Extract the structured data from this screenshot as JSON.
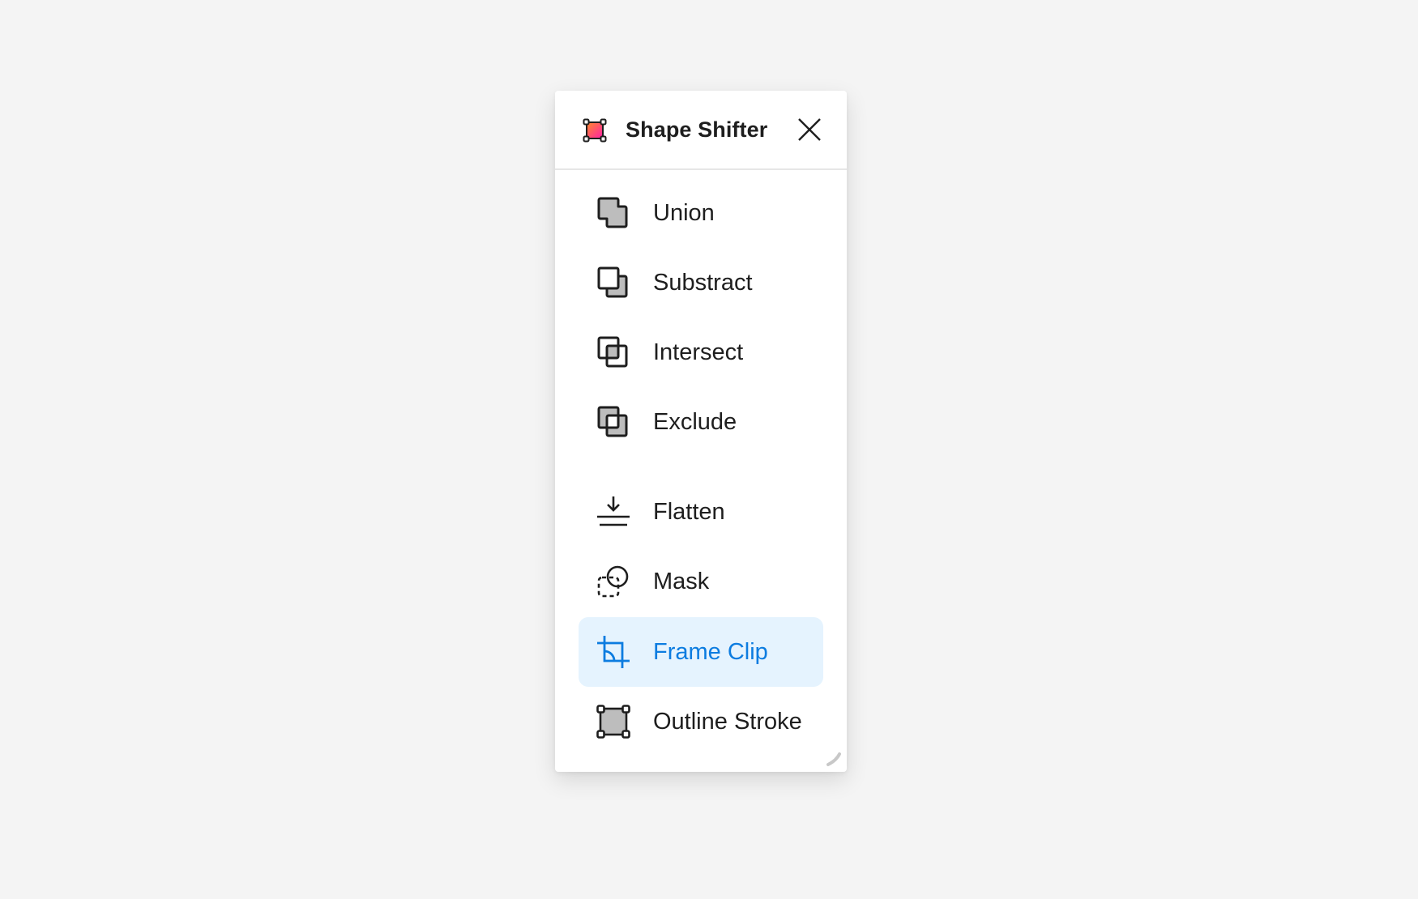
{
  "panel": {
    "title": "Shape Shifter",
    "logo_icon": "shape-shifter-logo-icon",
    "close_icon": "close-icon",
    "accent_color": "#0c7ce0",
    "active_bg_color": "#e5f3fe"
  },
  "items": [
    {
      "label": "Union",
      "icon": "union-icon",
      "active": false
    },
    {
      "label": "Substract",
      "icon": "subtract-icon",
      "active": false
    },
    {
      "label": "Intersect",
      "icon": "intersect-icon",
      "active": false
    },
    {
      "label": "Exclude",
      "icon": "exclude-icon",
      "active": false
    },
    {
      "label": "Flatten",
      "icon": "flatten-icon",
      "active": false
    },
    {
      "label": "Mask",
      "icon": "mask-icon",
      "active": false
    },
    {
      "label": "Frame Clip",
      "icon": "frame-clip-icon",
      "active": true
    },
    {
      "label": "Outline Stroke",
      "icon": "outline-stroke-icon",
      "active": false
    }
  ]
}
